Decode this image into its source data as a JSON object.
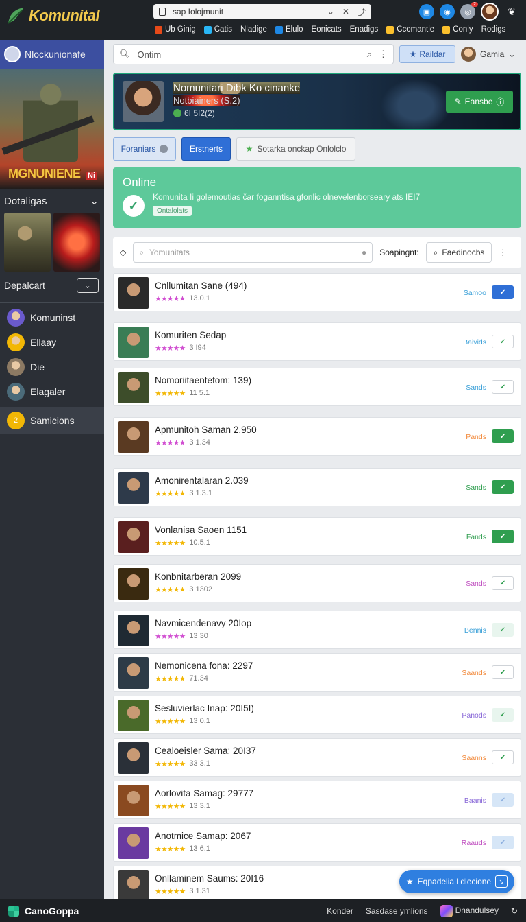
{
  "app": {
    "logo_text": "Komunital",
    "url": "sap Iolojmunit"
  },
  "top_icons": [
    "chat-icon",
    "eye-icon",
    "notifications-icon",
    "avatar",
    "leaf-icon"
  ],
  "bookmarks": [
    {
      "label": "Ub Ginig",
      "color": "#e64a19"
    },
    {
      "label": "Catis",
      "color": "#29b6f6"
    },
    {
      "label": "Nladige",
      "color": ""
    },
    {
      "label": "Elulo",
      "color": "#1e88e5"
    },
    {
      "label": "Eonicats",
      "color": ""
    },
    {
      "label": "Enadigs",
      "color": ""
    },
    {
      "label": "Ccomantle",
      "color": "#fbc02d"
    },
    {
      "label": "Conly",
      "color": "#fbc02d"
    },
    {
      "label": "Rodigs",
      "color": ""
    }
  ],
  "sidebar": {
    "header": "Nlockunionafe",
    "hero_title": "MGNUNIENE",
    "hero_tag": "Ni",
    "section": "Dotaligas",
    "select_label": "Depalcart",
    "nav": [
      {
        "label": "Komuninst",
        "color": "#6a5acd"
      },
      {
        "label": "Ellaay",
        "color": "#f2b705"
      },
      {
        "label": "Die",
        "color": "#8d7a63"
      },
      {
        "label": "Elagaler",
        "color": "#4b6b7a"
      }
    ],
    "active_item": {
      "label": "Samicions",
      "icon_text": "2"
    }
  },
  "search": {
    "placeholder": "Ontim",
    "button": "Raildar",
    "user": "Gamia"
  },
  "banner": {
    "title": "Nomunitari Dibk Ko cinanke",
    "subtitle": "Notbiainers (S.2)",
    "meta": "6I 5I2(2)",
    "button": "Eansbe"
  },
  "tabs": [
    {
      "label": "Foraniars"
    },
    {
      "label": "Erstnerts"
    },
    {
      "label": "Sotarka onckap Onlolclo"
    }
  ],
  "online": {
    "heading": "Online",
    "message": "Komunita Ii golemoutias čar foganntisa gfonlic olnevelenborseary ats IEI7",
    "pill": "Ontalolats"
  },
  "filter": {
    "placeholder": "Yomunitats",
    "sort_label": "Soapingnt:",
    "button": "Faedinocbs"
  },
  "rows": [
    {
      "name": "Cnllumitan Sane (494)",
      "rating": "13.0.1",
      "status": "Samoo",
      "status_color": "#3aa0d8",
      "stars_color": "#d14fd1",
      "thumb": "#2a2a2a",
      "act_bg": "#2f6fd6",
      "act_fg": "#fff"
    },
    {
      "name": "Komuriten Sedap",
      "rating": "3 I94",
      "status": "Baivids",
      "status_color": "#3aa0d8",
      "stars_color": "#d14fd1",
      "thumb": "#3a7d55",
      "act_bg": "#fff",
      "act_fg": "#2f9e4f"
    },
    {
      "name": "Nomoriitaentefom: 139)",
      "rating": "11 5.1",
      "status": "Sands",
      "status_color": "#3aa0d8",
      "stars_color": "#f2b705",
      "thumb": "#3d4d2a",
      "act_bg": "#fff",
      "act_fg": "#2f9e4f"
    },
    {
      "name": "Apmunitoh Saman 2.950",
      "rating": "3 1.34",
      "status": "Pands",
      "status_color": "#f28a3c",
      "stars_color": "#d14fd1",
      "thumb": "#5a3a22",
      "act_bg": "#2f9e4f",
      "act_fg": "#fff"
    },
    {
      "name": "Amonirentalaran 2.039",
      "rating": "3 1.3.1",
      "status": "Sands",
      "status_color": "#2f9e4f",
      "stars_color": "#f2b705",
      "thumb": "#2e3a4a",
      "act_bg": "#2f9e4f",
      "act_fg": "#fff"
    },
    {
      "name": "Vonlanisa Saoen 1151",
      "rating": "10.5.1",
      "status": "Fands",
      "status_color": "#2f9e4f",
      "stars_color": "#f2b705",
      "thumb": "#5a1f1f",
      "act_bg": "#2f9e4f",
      "act_fg": "#fff"
    },
    {
      "name": "Konbnitarberan 2099",
      "rating": "3 1302",
      "status": "Sands",
      "status_color": "#c04fc0",
      "stars_color": "#f2b705",
      "thumb": "#3a2a10",
      "act_bg": "#fff",
      "act_fg": "#2f9e4f"
    },
    {
      "name": "Navmicendenavy 20Iop",
      "rating": "13 30",
      "status": "Bennis",
      "status_color": "#3aa0d8",
      "stars_color": "#d14fd1",
      "thumb": "#1f2a33",
      "act_bg": "#e8f5ee",
      "act_fg": "#2f9e4f"
    },
    {
      "name": "Nemonicena fona: 2297",
      "rating": "71.34",
      "status": "Saands",
      "status_color": "#f28a3c",
      "stars_color": "#f2b705",
      "thumb": "#2d3b47",
      "act_bg": "#fff",
      "act_fg": "#2f9e4f"
    },
    {
      "name": "Sesluvierlac Inap: 20I5I)",
      "rating": "13 0.1",
      "status": "Panods",
      "status_color": "#8a6ad8",
      "stars_color": "#f2b705",
      "thumb": "#4a6a2a",
      "act_bg": "#e8f5ee",
      "act_fg": "#2f9e4f"
    },
    {
      "name": "Cealoeisler Sama: 20I37",
      "rating": "33 3.1",
      "status": "Saanns",
      "status_color": "#f28a3c",
      "stars_color": "#f2b705",
      "thumb": "#2a3038",
      "act_bg": "#fff",
      "act_fg": "#2f9e4f"
    },
    {
      "name": "Aorlovita Samag: 29777",
      "rating": "13 3.1",
      "status": "Baanis",
      "status_color": "#8a6ad8",
      "stars_color": "#f2b705",
      "thumb": "#8a4a20",
      "act_bg": "#d6e6f7",
      "act_fg": "#8fb1e0"
    },
    {
      "name": "Anotmice Samap: 2067",
      "rating": "13 6.1",
      "status": "Raauds",
      "status_color": "#c04fc0",
      "stars_color": "#f2b705",
      "thumb": "#6a3aa0",
      "act_bg": "#d6e6f7",
      "act_fg": "#8fb1e0"
    },
    {
      "name": "Onllaminem Saums: 20I16",
      "rating": "3 1.31",
      "status": "",
      "status_color": "#3aa0d8",
      "stars_color": "#f2b705",
      "thumb": "#3a3a3a",
      "act_bg": "#fff",
      "act_fg": "#fff"
    }
  ],
  "fab": {
    "label": "Eqpadelia l dlecione"
  },
  "footer": {
    "brand": "CanoGoppa",
    "links": [
      "Konder",
      "Sasdase ymlions",
      "Dnandulsey"
    ]
  }
}
